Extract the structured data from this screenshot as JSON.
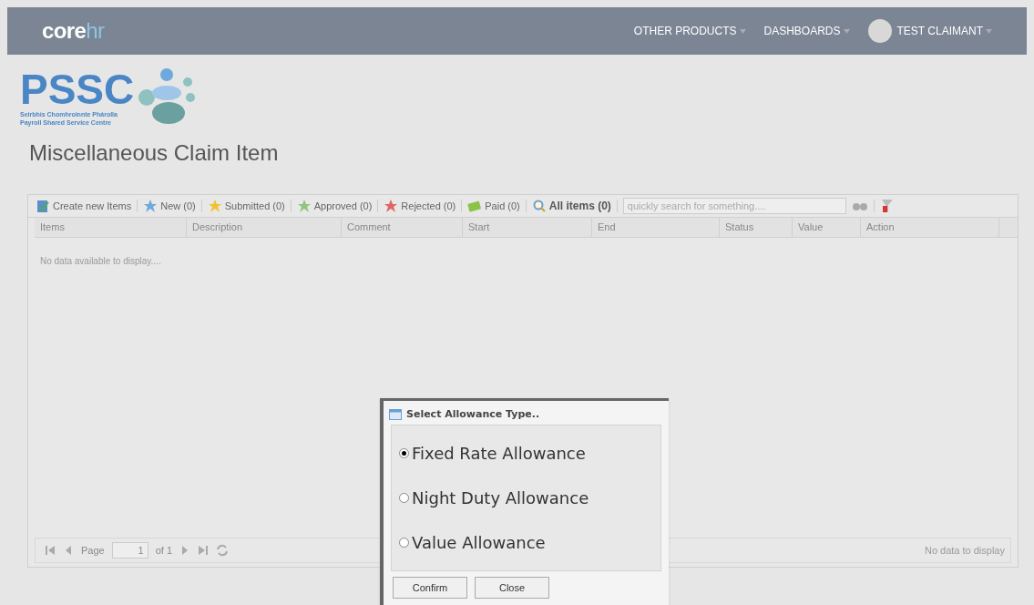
{
  "nav": {
    "brand": [
      "core",
      "hr"
    ],
    "menus": [
      "OTHER PRODUCTS",
      "DASHBOARDS"
    ],
    "user": "TEST CLAIMANT"
  },
  "logo": {
    "name": "PSSC",
    "lines": [
      "Seirbhís Chomhroinnte Phárolla",
      "Payroll Shared Service Centre"
    ]
  },
  "page_title": "Miscellaneous Claim Item",
  "toolbar": [
    {
      "kind": "create",
      "label": "Create new Items",
      "selected": false
    },
    {
      "kind": "star",
      "color": "#6fa8dc",
      "label": "New (0)",
      "selected": false
    },
    {
      "kind": "star",
      "color": "#f1c232",
      "label": "Submitted (0)",
      "selected": false
    },
    {
      "kind": "star",
      "color": "#93c47d",
      "label": "Approved (0)",
      "selected": false
    },
    {
      "kind": "star",
      "color": "#e06666",
      "label": "Rejected (0)",
      "selected": false
    },
    {
      "kind": "paid",
      "label": "Paid (0)",
      "selected": false
    },
    {
      "kind": "all",
      "label": "All items (0)",
      "selected": true
    }
  ],
  "search": {
    "placeholder": "quickly search for something...."
  },
  "table": {
    "columns": [
      "Items",
      "Description",
      "Comment",
      "Start",
      "End",
      "Status",
      "Value",
      "Action"
    ],
    "empty": "No data available to display...."
  },
  "pager": {
    "label": "Page",
    "value": "1",
    "of": "of 1",
    "status": "No data to display"
  },
  "dialog": {
    "title": "Select Allowance Type..",
    "options": [
      {
        "label": "Fixed Rate Allowance",
        "selected": true
      },
      {
        "label": "Night Duty Allowance",
        "selected": false
      },
      {
        "label": "Value Allowance",
        "selected": false
      }
    ],
    "buttons": [
      "Confirm",
      "Close"
    ]
  }
}
